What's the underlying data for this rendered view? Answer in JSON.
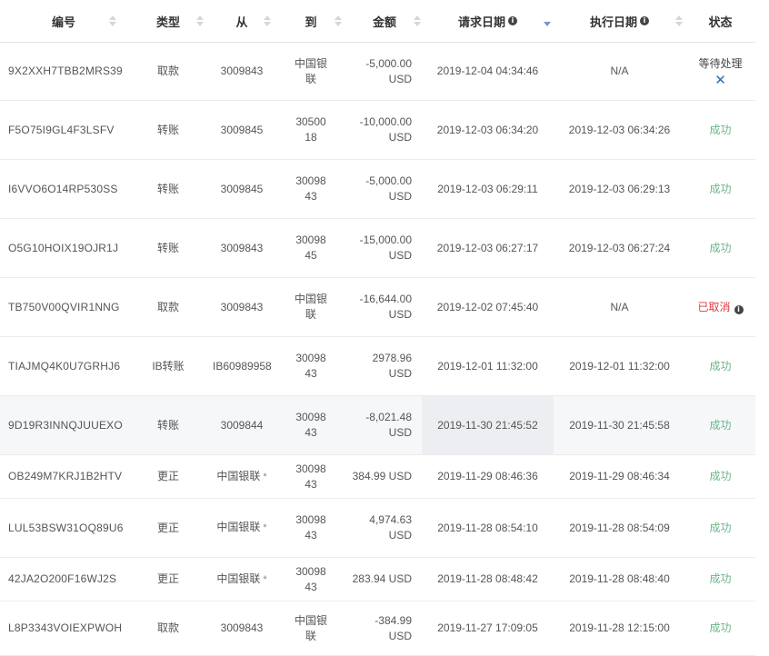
{
  "columns": {
    "ref": "编号",
    "type": "类型",
    "from": "从",
    "to": "到",
    "amount": "金额",
    "request_date": "请求日期",
    "exec_date": "执行日期",
    "status": "状态"
  },
  "sort": {
    "column": "request_date",
    "direction": "desc"
  },
  "status_colors": {
    "success": "#6cb58c",
    "cancelled": "#e0393e",
    "accent": "#7f8fd6"
  },
  "rows": [
    {
      "ref": "9X2XXH7TBB2MRS39",
      "type": "取款",
      "from": "3009843",
      "to": "中国银联",
      "amount": "-5,000.00",
      "currency": "USD",
      "requested": "2019-12-04 04:34:46",
      "executed": "N/A",
      "status": "等待处理",
      "status_kind": "pending"
    },
    {
      "ref": "F5O75I9GL4F3LSFV",
      "type": "转账",
      "from": "3009845",
      "to": "3050018",
      "amount": "-10,000.00",
      "currency": "USD",
      "requested": "2019-12-03 06:34:20",
      "executed": "2019-12-03 06:34:26",
      "status": "成功",
      "status_kind": "success"
    },
    {
      "ref": "I6VVO6O14RP530SS",
      "type": "转账",
      "from": "3009845",
      "to": "3009843",
      "amount": "-5,000.00",
      "currency": "USD",
      "requested": "2019-12-03 06:29:11",
      "executed": "2019-12-03 06:29:13",
      "status": "成功",
      "status_kind": "success"
    },
    {
      "ref": "O5G10HOIX19OJR1J",
      "type": "转账",
      "from": "3009843",
      "to": "3009845",
      "amount": "-15,000.00",
      "currency": "USD",
      "requested": "2019-12-03 06:27:17",
      "executed": "2019-12-03 06:27:24",
      "status": "成功",
      "status_kind": "success"
    },
    {
      "ref": "TB750V00QVIR1NNG",
      "type": "取款",
      "from": "3009843",
      "to": "中国银联",
      "amount": "-16,644.00",
      "currency": "USD",
      "requested": "2019-12-02 07:45:40",
      "executed": "N/A",
      "status": "已取消",
      "status_kind": "cancelled"
    },
    {
      "ref": "TIAJMQ4K0U7GRHJ6",
      "type": "IB转账",
      "from": "IB60989958",
      "to": "3009843",
      "amount": "2978.96",
      "currency": "USD",
      "requested": "2019-12-01 11:32:00",
      "executed": "2019-12-01 11:32:00",
      "status": "成功",
      "status_kind": "success"
    },
    {
      "ref": "9D19R3INNQJUUEXO",
      "type": "转账",
      "from": "3009844",
      "to": "3009843",
      "amount": "-8,021.48",
      "currency": "USD",
      "requested": "2019-11-30 21:45:52",
      "executed": "2019-11-30 21:45:58",
      "status": "成功",
      "status_kind": "success",
      "highlight": true
    },
    {
      "ref": "OB249M7KRJ1B2HTV",
      "type": "更正",
      "from": "中国银联",
      "from_mark": "*",
      "to": "3009843",
      "amount": "384.99 USD",
      "currency": "",
      "requested": "2019-11-29 08:46:36",
      "executed": "2019-11-29 08:46:34",
      "status": "成功",
      "status_kind": "success"
    },
    {
      "ref": "LUL53BSW31OQ89U6",
      "type": "更正",
      "from": "中国银联",
      "from_mark": "*",
      "to": "3009843",
      "amount": "4,974.63",
      "currency": "USD",
      "requested": "2019-11-28 08:54:10",
      "executed": "2019-11-28 08:54:09",
      "status": "成功",
      "status_kind": "success"
    },
    {
      "ref": "42JA2O200F16WJ2S",
      "type": "更正",
      "from": "中国银联",
      "from_mark": "*",
      "to": "3009843",
      "amount": "283.94 USD",
      "currency": "",
      "requested": "2019-11-28 08:48:42",
      "executed": "2019-11-28 08:48:40",
      "status": "成功",
      "status_kind": "success"
    },
    {
      "ref": "L8P3343VOIEXPWOH",
      "type": "取款",
      "from": "3009843",
      "to": "中国银联",
      "amount": "-384.99",
      "currency": "USD",
      "requested": "2019-11-27 17:09:05",
      "executed": "2019-11-28 12:15:00",
      "status": "成功",
      "status_kind": "success"
    }
  ]
}
